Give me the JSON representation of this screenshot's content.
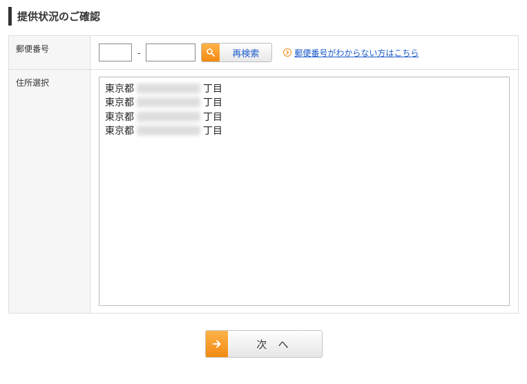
{
  "heading": "提供状況のご確認",
  "zip": {
    "label": "郵便番号",
    "part1": "",
    "part2": "",
    "separator": "-",
    "search_button": "再検索",
    "help_link": "郵便番号がわからない方はこちら"
  },
  "address": {
    "label": "住所選択",
    "items": [
      {
        "prefix": "東京都",
        "suffix": "丁目"
      },
      {
        "prefix": "東京都",
        "suffix": "丁目"
      },
      {
        "prefix": "東京都",
        "suffix": "丁目"
      },
      {
        "prefix": "東京都",
        "suffix": "丁目"
      }
    ]
  },
  "next_button": "次 へ"
}
